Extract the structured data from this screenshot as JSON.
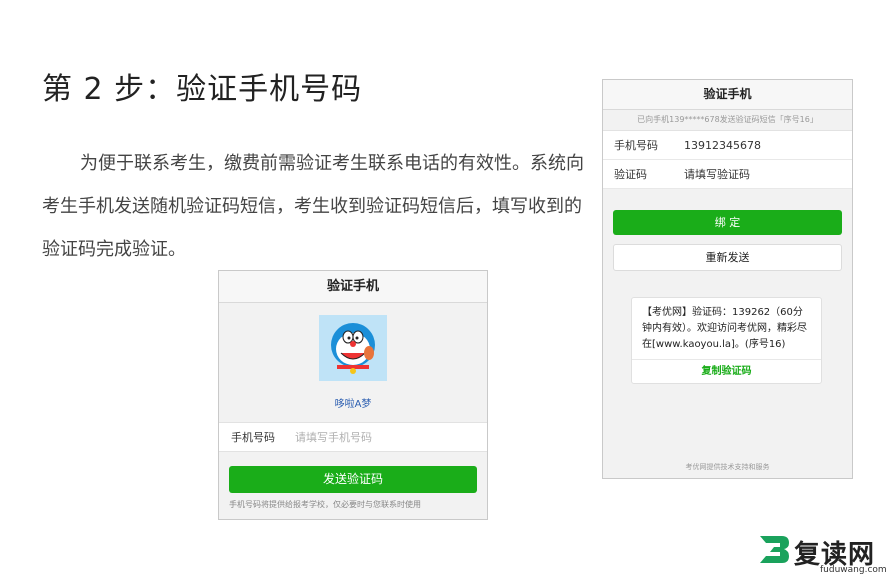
{
  "title": "第 2 步：验证手机号码",
  "paragraph": "为便于联系考生，缴费前需验证考生联系电话的有效性。系统向考生手机发送随机验证码短信，考生收到验证码短信后，填写收到的验证码完成验证。",
  "panel1": {
    "header": "验证手机",
    "nickname": "哆啦A梦",
    "phone_label": "手机号码",
    "phone_placeholder": "请填写手机号码",
    "send_button": "发送验证码",
    "note": "手机号码将提供给报考学校，仅必要时与您联系时使用"
  },
  "panel2": {
    "header": "验证手机",
    "subtitle": "已向手机139*****678发送验证码短信「序号16」",
    "phone_label": "手机号码",
    "phone_value": "13912345678",
    "code_label": "验证码",
    "code_placeholder": "请填写验证码",
    "bind_button": "绑 定",
    "resend_button": "重新发送",
    "sms_text": "【考优网】验证码：139262（60分钟内有效）。欢迎访问考优网，精彩尽在[www.kaoyou.la]。(序号16)",
    "copy_button": "复制验证码",
    "footer": "考优网提供技术支持和服务"
  },
  "logo": {
    "name": "复读网",
    "domain": "fuduwang.com"
  },
  "colors": {
    "accent_green": "#1aad19",
    "avatar_bg": "#bfe3f7"
  }
}
